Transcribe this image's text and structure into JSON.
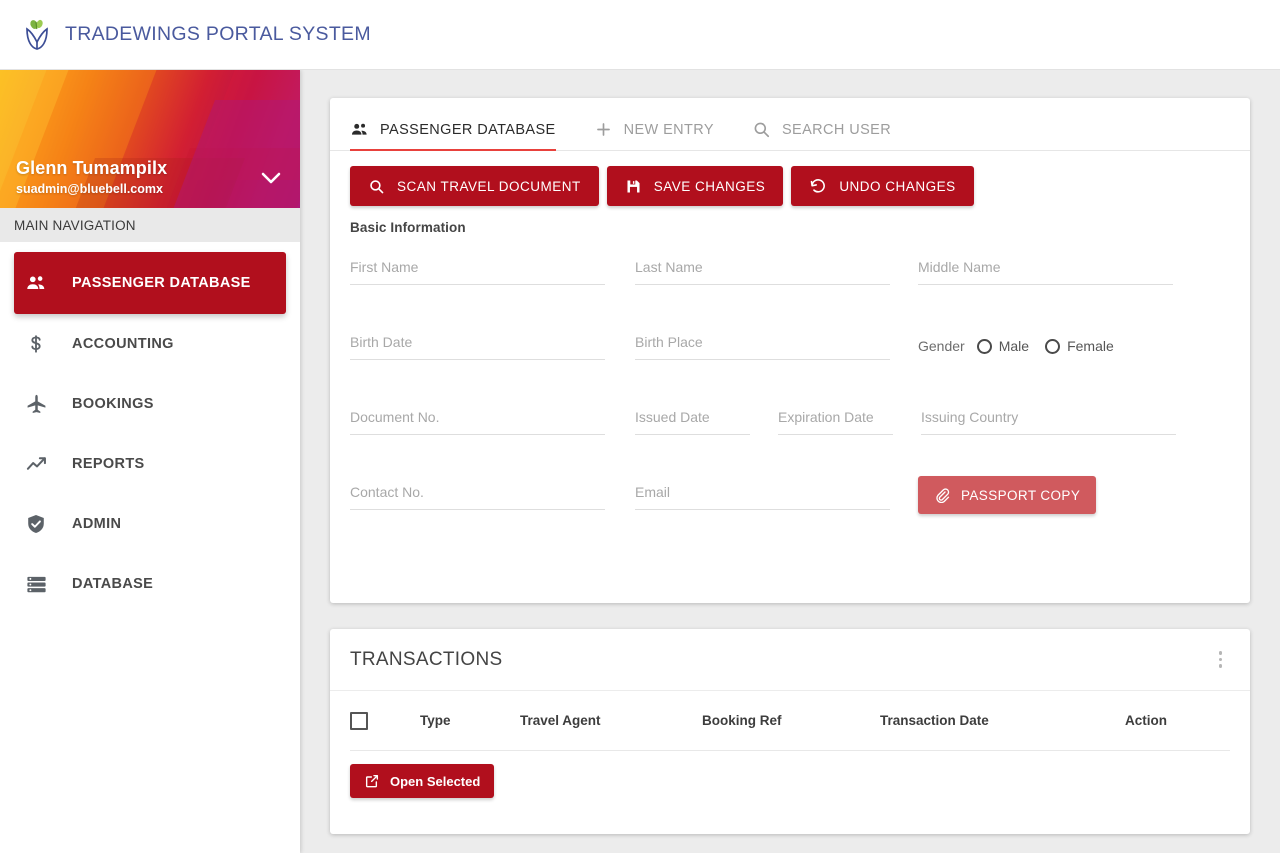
{
  "app": {
    "brand_title": "TRADEWINGS PORTAL SYSTEM",
    "accent_red": "#b10f1d",
    "accent_tab": "#e8413c",
    "brand_blue": "#4a5a9e",
    "passport_red": "#d05a5e"
  },
  "sidebar": {
    "profile": {
      "name": "Glenn Tumampilx",
      "email": "suadmin@bluebell.comx",
      "caret_icon": "chevron-down-icon"
    },
    "nav_header": "MAIN NAVIGATION",
    "items": [
      {
        "label": "PASSENGER DATABASE",
        "icon": "people-icon",
        "active": true
      },
      {
        "label": "ACCOUNTING",
        "icon": "dollar-icon",
        "active": false
      },
      {
        "label": "BOOKINGS",
        "icon": "airplane-icon",
        "active": false
      },
      {
        "label": "REPORTS",
        "icon": "trending-up-icon",
        "active": false
      },
      {
        "label": "ADMIN",
        "icon": "shield-check-icon",
        "active": false
      },
      {
        "label": "DATABASE",
        "icon": "database-icon",
        "active": false
      }
    ]
  },
  "main": {
    "tabs": [
      {
        "label": "PASSENGER DATABASE",
        "icon": "people-icon",
        "active": true
      },
      {
        "label": "NEW ENTRY",
        "icon": "plus-icon",
        "active": false
      },
      {
        "label": "SEARCH USER",
        "icon": "search-icon",
        "active": false
      }
    ],
    "actions": [
      {
        "label": "SCAN TRAVEL DOCUMENT",
        "icon": "search-icon"
      },
      {
        "label": "SAVE CHANGES",
        "icon": "save-icon"
      },
      {
        "label": "UNDO CHANGES",
        "icon": "undo-icon"
      }
    ],
    "section_label": "Basic Information",
    "fields": {
      "first_name": {
        "placeholder": "First Name",
        "value": ""
      },
      "last_name": {
        "placeholder": "Last Name",
        "value": ""
      },
      "middle_name": {
        "placeholder": "Middle Name",
        "value": ""
      },
      "birth_date": {
        "placeholder": "Birth Date",
        "value": ""
      },
      "birth_place": {
        "placeholder": "Birth Place",
        "value": ""
      },
      "document_no": {
        "placeholder": "Document No.",
        "value": ""
      },
      "issued_date": {
        "placeholder": "Issued Date",
        "value": ""
      },
      "expiration_date": {
        "placeholder": "Expiration Date",
        "value": ""
      },
      "issuing_country": {
        "placeholder": "Issuing Country",
        "value": ""
      },
      "contact_no": {
        "placeholder": "Contact No.",
        "value": ""
      },
      "email": {
        "placeholder": "Email",
        "value": ""
      }
    },
    "gender": {
      "label": "Gender",
      "options": [
        "Male",
        "Female"
      ],
      "selected": ""
    },
    "passport_button": {
      "label": "PASSPORT COPY",
      "icon": "paperclip-icon"
    }
  },
  "transactions": {
    "title": "TRANSACTIONS",
    "menu_icon": "kebab-menu-icon",
    "columns": [
      "Type",
      "Travel Agent",
      "Booking Ref",
      "Transaction Date",
      "Action"
    ],
    "rows": [],
    "open_button": {
      "label": "Open Selected",
      "icon": "external-link-icon"
    }
  }
}
